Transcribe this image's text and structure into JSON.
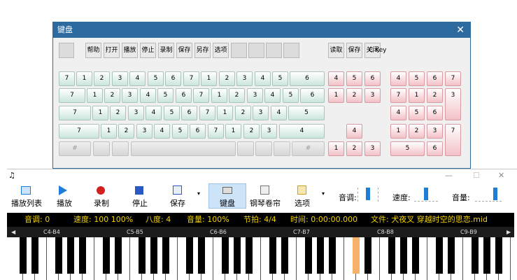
{
  "keyboard_dialog": {
    "title": "键盘",
    "toolbar": [
      "帮助",
      "打开",
      "播放",
      "停止",
      "录制",
      "保存",
      "另存",
      "选项"
    ],
    "right_buttons": [
      "读取",
      "保存",
      "关闭"
    ],
    "key_label": "C Key",
    "row1": [
      "7",
      "1",
      "2",
      "3",
      "4",
      "5",
      "6",
      "7",
      "1",
      "2",
      "3",
      "4",
      "5",
      "6"
    ],
    "row2": [
      "7",
      "1",
      "2",
      "3",
      "4",
      "5",
      "6",
      "7",
      "1",
      "2",
      "3",
      "4",
      "5",
      "6"
    ],
    "row3": [
      "7",
      "1",
      "2",
      "3",
      "4",
      "5",
      "6",
      "7",
      "1",
      "2",
      "3",
      "4",
      "5"
    ],
    "row4": [
      "7",
      "1",
      "2",
      "3",
      "4",
      "5",
      "6",
      "7",
      "1",
      "2",
      "3",
      "4"
    ],
    "row5_hash": "#",
    "nav_top": [
      "4",
      "5",
      "6"
    ],
    "nav_mid": [
      "1",
      "2",
      "3"
    ],
    "nav_up": "4",
    "nav_bottom": [
      "1",
      "2",
      "3"
    ],
    "numpad": [
      [
        "4",
        "5",
        "6",
        "7"
      ],
      [
        "7",
        "1",
        "2",
        "3"
      ],
      [
        "4",
        "5",
        "6"
      ],
      [
        "1",
        "2",
        "3",
        "7"
      ],
      [
        "5",
        "6"
      ]
    ]
  },
  "main_window": {
    "toolbar": [
      "播放列表",
      "播放",
      "录制",
      "停止",
      "保存",
      "键盘",
      "钢琴卷帘",
      "选项"
    ],
    "tone_label": "音调:",
    "speed_label": "速度:",
    "volume_label": "音量:",
    "status": {
      "tone": "音调: 0",
      "speed": "速度: 100 100%",
      "octave": "八度: 4",
      "volume": "音量: 100%",
      "beat": "节拍: 4/4",
      "time": "时间: 0:00:00.000",
      "file": "文件: 犬夜叉 穿越时空的思恋.mid"
    },
    "octaves": [
      "C4-B4",
      "C5-B5",
      "C6-B6",
      "C7-B7",
      "C8-B8",
      "C9-B9"
    ]
  },
  "colors": {
    "title_bar": "#2d6a9f",
    "status_text": "#f2d300",
    "highlight_key": "#f6b26b",
    "accent": "#1e7ed6"
  }
}
